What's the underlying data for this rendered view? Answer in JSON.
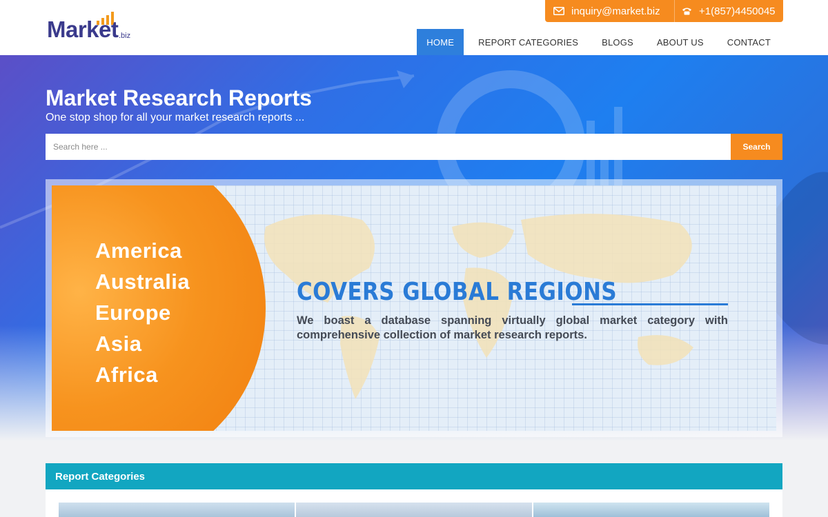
{
  "header": {
    "logo_text": "Market",
    "logo_suffix": ".biz",
    "contact": {
      "email": "inquiry@market.biz",
      "phone": "+1(857)4450045"
    },
    "nav": [
      {
        "label": "HOME",
        "active": true
      },
      {
        "label": "REPORT CATEGORIES",
        "active": false
      },
      {
        "label": "BLOGS",
        "active": false
      },
      {
        "label": "ABOUT US",
        "active": false
      },
      {
        "label": "CONTACT",
        "active": false
      }
    ]
  },
  "hero": {
    "title": "Market Research Reports",
    "subtitle": "One stop shop for all your market research reports ...",
    "search": {
      "placeholder": "Search here ...",
      "button_label": "Search"
    }
  },
  "banner": {
    "regions": [
      "America",
      "Australia",
      "Europe",
      "Asia",
      "Africa"
    ],
    "heading": "COVERS GLOBAL REGIONS",
    "text": "We boast a database spanning virtually global market category with comprehensive collection of market research reports."
  },
  "categories": {
    "title": "Report Categories"
  },
  "colors": {
    "accent_orange": "#f68b1f",
    "nav_active_blue": "#2e7fdc",
    "category_teal": "#12a6c1",
    "logo_navy": "#3a3a8c"
  }
}
